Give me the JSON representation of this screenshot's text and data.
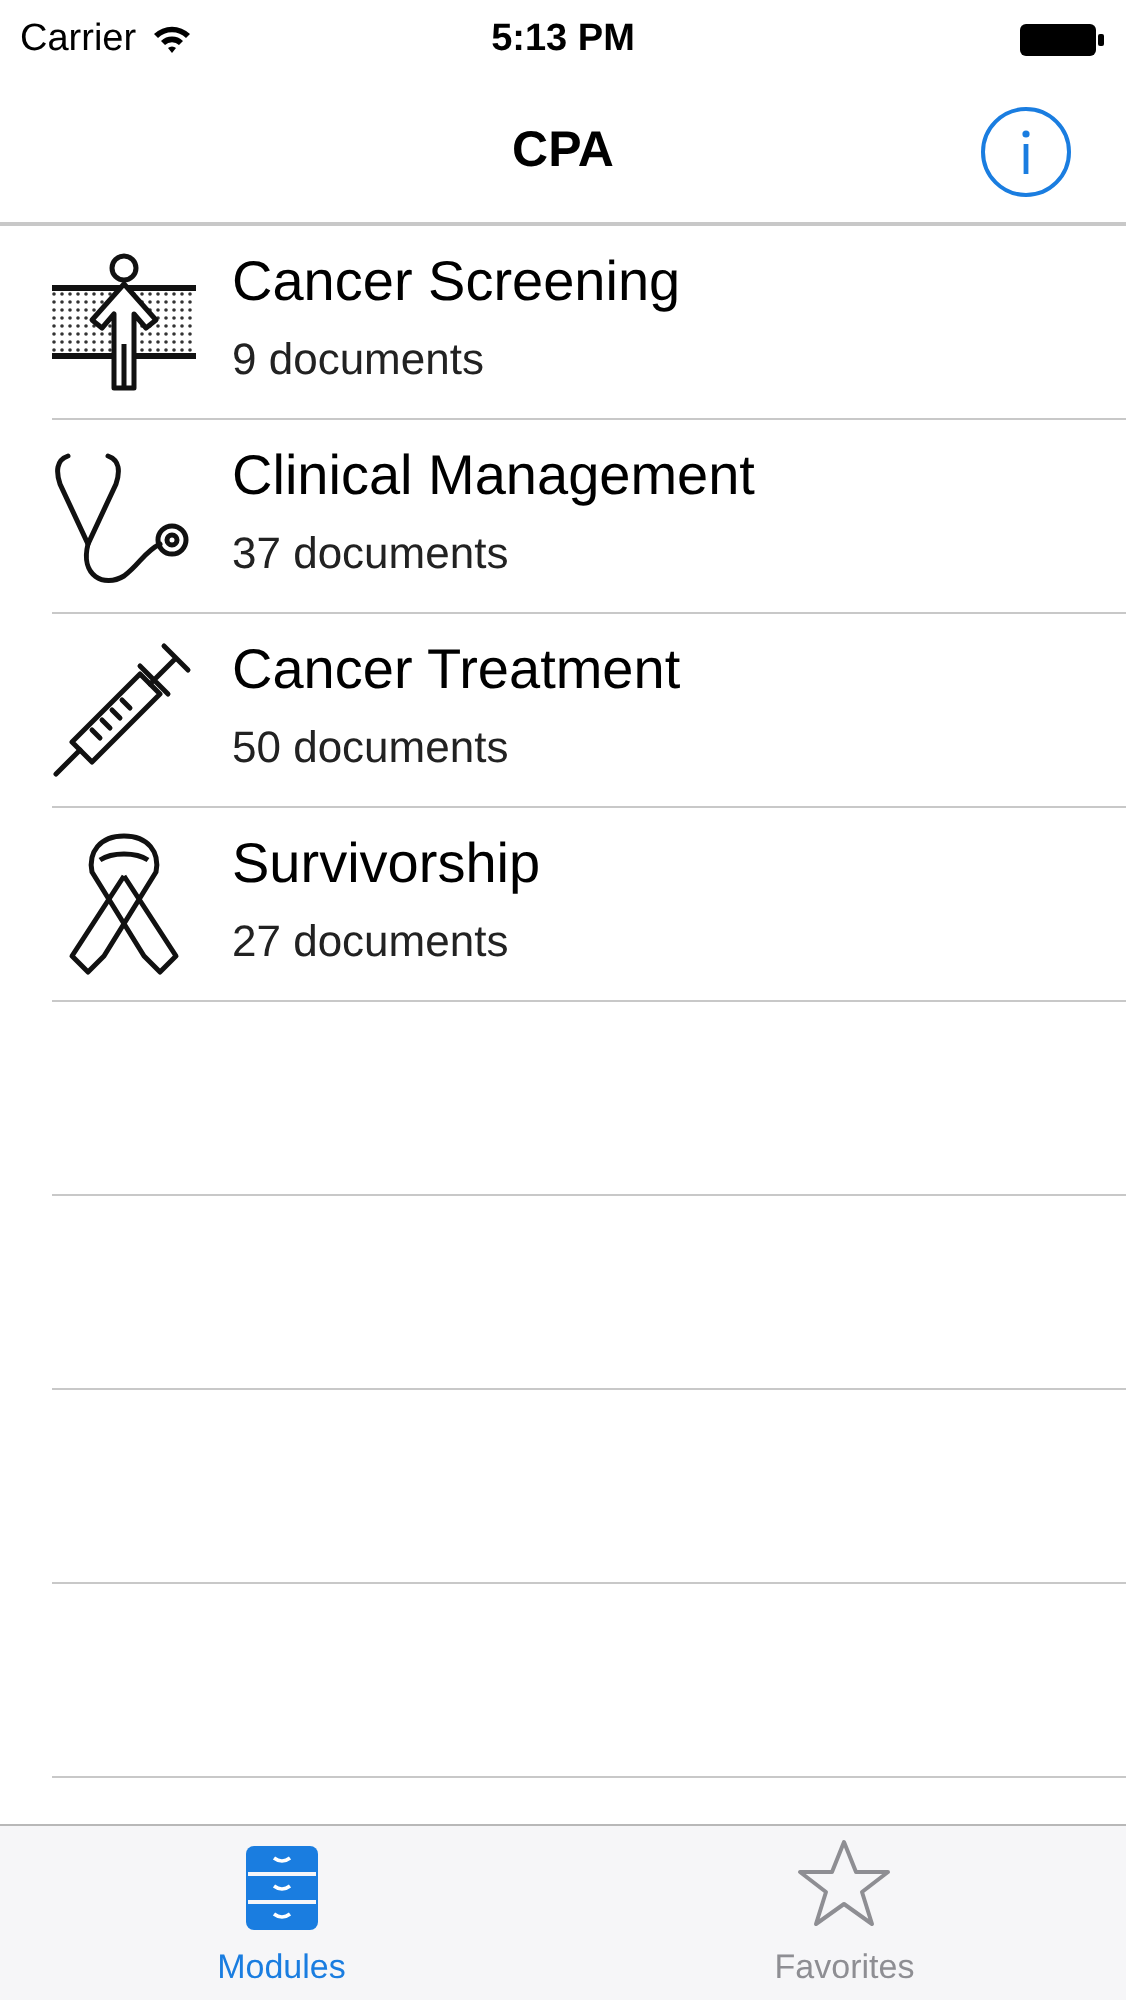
{
  "status_bar": {
    "carrier": "Carrier",
    "time": "5:13 PM"
  },
  "nav_bar": {
    "title": "CPA"
  },
  "modules": [
    {
      "kind": "screening",
      "title": "Cancer Screening",
      "subtitle": "9 documents"
    },
    {
      "kind": "stethoscope",
      "title": "Clinical Management",
      "subtitle": "37 documents"
    },
    {
      "kind": "syringe",
      "title": "Cancer Treatment",
      "subtitle": "50 documents"
    },
    {
      "kind": "ribbon",
      "title": "Survivorship",
      "subtitle": "27 documents"
    }
  ],
  "tab_bar": [
    {
      "kind": "modules",
      "label": "Modules",
      "selected": true
    },
    {
      "kind": "favorites",
      "label": "Favorites",
      "selected": false
    }
  ]
}
